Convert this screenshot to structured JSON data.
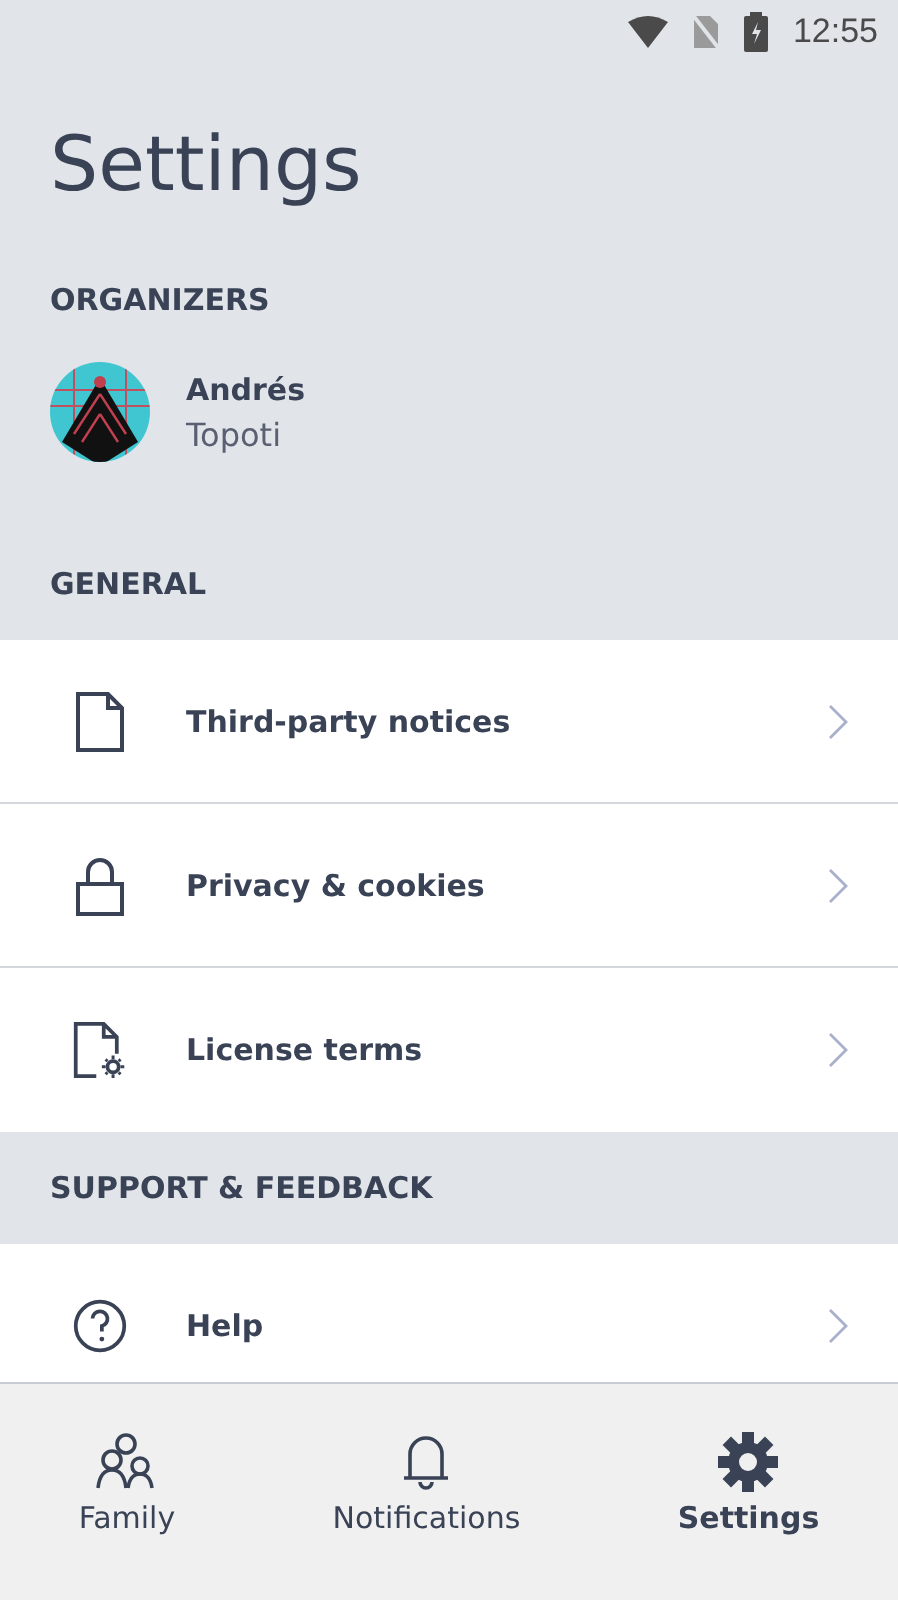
{
  "status_bar": {
    "time": "12:55"
  },
  "title": "Settings",
  "organizers": {
    "heading": "ORGANIZERS",
    "people": [
      {
        "name": "Andrés",
        "subtitle": "Topoti"
      }
    ]
  },
  "sections": [
    {
      "heading": "GENERAL",
      "items": [
        {
          "label": "Third-party notices",
          "kind": "document"
        },
        {
          "label": "Privacy & cookies",
          "kind": "lock"
        },
        {
          "label": "License terms",
          "kind": "document-gear"
        }
      ]
    },
    {
      "heading": "SUPPORT & FEEDBACK",
      "items": [
        {
          "label": "Help",
          "kind": "help"
        }
      ]
    }
  ],
  "bottom_nav": [
    {
      "label": "Family",
      "kind": "family",
      "selected": false
    },
    {
      "label": "Notifications",
      "kind": "bell",
      "selected": false
    },
    {
      "label": "Settings",
      "kind": "gear",
      "selected": true
    }
  ]
}
